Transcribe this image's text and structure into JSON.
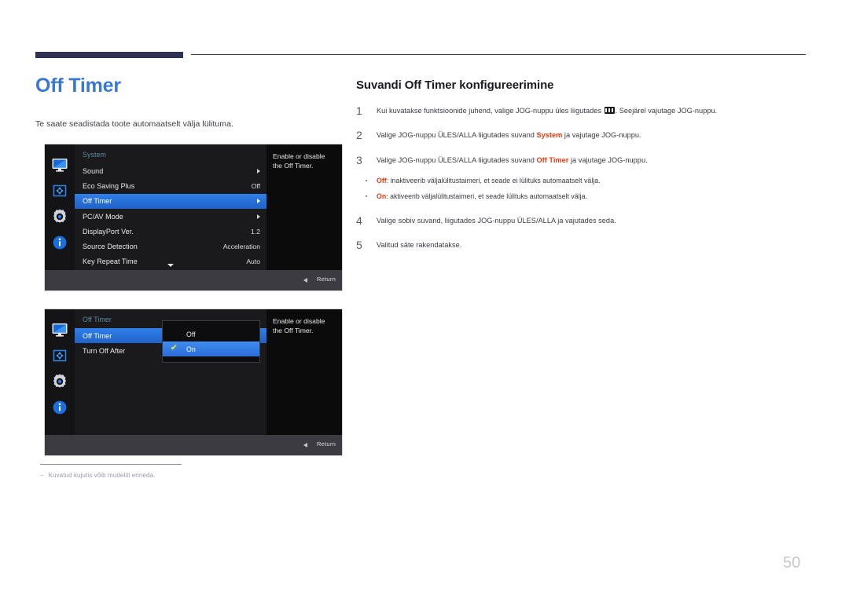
{
  "document": {
    "title": "Off Timer",
    "intro": "Te saate seadistada toote automaatselt välja lülituma.",
    "page_number": "50",
    "footnote_dash": "–",
    "footnote": "Kuvatud kujutis võib mudeliti erineda."
  },
  "section": {
    "heading": "Suvandi Off Timer konfigureerimine",
    "steps": [
      {
        "num": "1",
        "text_before": "Kui kuvatakse funktsioonide juhend, valige JOG-nuppu üles liigutades ",
        "icon": "menu-icon",
        "text_after": ". Seejärel vajutage JOG-nuppu."
      },
      {
        "num": "2",
        "text_before": "Valige JOG-nuppu ÜLES/ALLA liigutades suvand ",
        "highlight": "System",
        "text_after": " ja vajutage JOG-nuppu."
      },
      {
        "num": "3",
        "text_before": "Valige JOG-nuppu ÜLES/ALLA liigutades suvand ",
        "highlight": "Off Timer",
        "text_after": " ja vajutage JOG-nuppu."
      },
      {
        "num": "4",
        "text_before": "Valige sobiv suvand, liigutades JOG-nuppu ÜLES/ALLA ja vajutades seda.",
        "highlight": "",
        "text_after": ""
      },
      {
        "num": "5",
        "text_before": "Valitud säte rakendatakse.",
        "highlight": "",
        "text_after": ""
      }
    ],
    "bullets": [
      {
        "highlight": "Off",
        "text": ": inaktiveerib väljalülitustaimeri, et seade ei lülituks automaatselt välja."
      },
      {
        "highlight": "On",
        "text": ": aktiveerib väljalülitustaimeri, et seade lülituks automaatselt välja."
      }
    ]
  },
  "osd_menu_1": {
    "category": "System",
    "description": "Enable or disable the Off Timer.",
    "return_label": "Return",
    "sidebar_icons": [
      "monitor-icon",
      "screen-adjust-icon",
      "gear-icon",
      "info-icon"
    ],
    "rows": [
      {
        "label": "Sound",
        "value": "",
        "arrow": true,
        "selected": false
      },
      {
        "label": "Eco Saving Plus",
        "value": "Off",
        "arrow": false,
        "selected": false
      },
      {
        "label": "Off Timer",
        "value": "",
        "arrow": true,
        "selected": true
      },
      {
        "label": "PC/AV Mode",
        "value": "",
        "arrow": true,
        "selected": false
      },
      {
        "label": "DisplayPort Ver.",
        "value": "1.2",
        "arrow": false,
        "selected": false
      },
      {
        "label": "Source Detection",
        "value": "Acceleration",
        "arrow": false,
        "selected": false
      },
      {
        "label": "Key Repeat Time",
        "value": "Auto",
        "arrow": false,
        "selected": false
      }
    ]
  },
  "osd_menu_2": {
    "category": "Off Timer",
    "description": "Enable or disable the Off Timer.",
    "return_label": "Return",
    "sidebar_icons": [
      "monitor-icon",
      "screen-adjust-icon",
      "gear-icon",
      "info-icon"
    ],
    "rows": [
      {
        "label": "Off Timer",
        "value": "",
        "arrow": false,
        "selected": true
      },
      {
        "label": "Turn Off After",
        "value": "",
        "arrow": false,
        "selected": false
      }
    ],
    "dropdown": {
      "options": [
        {
          "label": "Off",
          "checked": false
        },
        {
          "label": "On",
          "checked": true
        }
      ],
      "check_glyph": "✔"
    }
  },
  "colors": {
    "title_blue": "#3a78d0",
    "rule_navy": "#2e3154",
    "highlight_red": "#e8380d",
    "osd_select_blue": "#2f7fe8",
    "osd_category": "#5b8da5",
    "page_number_gray": "#c6c6cf"
  }
}
